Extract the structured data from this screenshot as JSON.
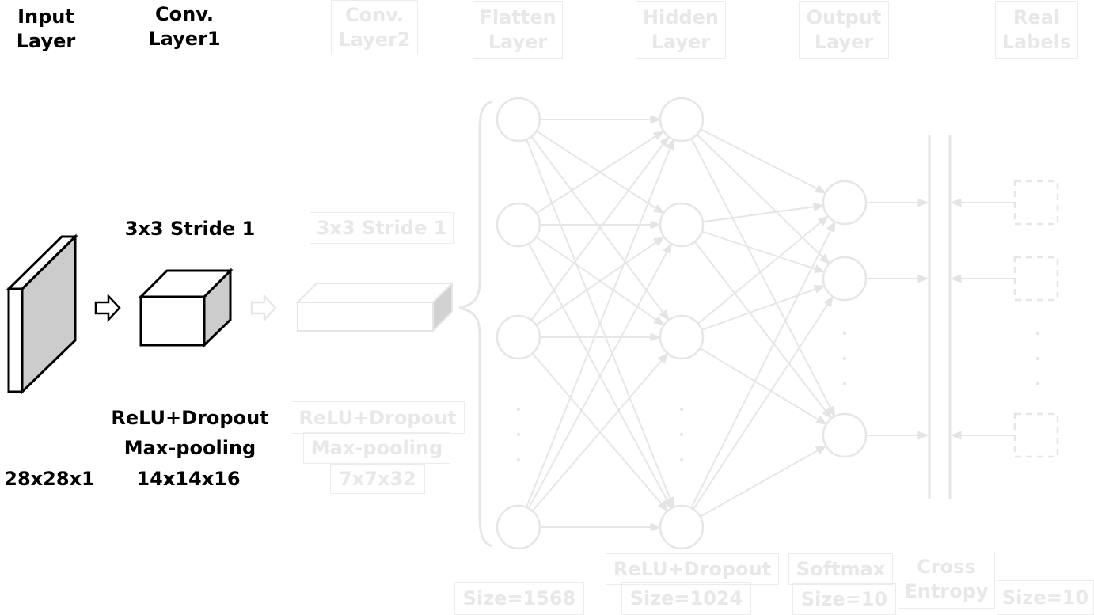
{
  "colors": {
    "active_stroke": "#000000",
    "active_fill_shade": "#cccccc",
    "faded_stroke": "#e6e6e6",
    "faded_text": "#e8e8e8"
  },
  "layers": {
    "input": {
      "title_l1": "Input",
      "title_l2": "Layer",
      "size": "28x28x1"
    },
    "conv1": {
      "title_l1": "Conv.",
      "title_l2": "Layer1",
      "kernel": "3x3 Stride 1",
      "act": "ReLU+Dropout",
      "pool": "Max-pooling",
      "size": "14x14x16"
    },
    "conv2": {
      "title_l1": "Conv.",
      "title_l2": "Layer2",
      "kernel": "3x3 Stride 1",
      "act": "ReLU+Dropout",
      "pool": "Max-pooling",
      "size": "7x7x32"
    },
    "flatten": {
      "title_l1": "Flatten",
      "title_l2": "Layer",
      "size": "Size=1568"
    },
    "hidden": {
      "title_l1": "Hidden",
      "title_l2": "Layer",
      "act": "ReLU+Dropout",
      "size": "Size=1024"
    },
    "output": {
      "title_l1": "Output",
      "title_l2": "Layer",
      "act": "Softmax",
      "size": "Size=10"
    },
    "loss": {
      "title_l1": "Cross",
      "title_l2": "Entropy"
    },
    "labels": {
      "title_l1": "Real",
      "title_l2": "Labels",
      "size": "Size=10"
    }
  }
}
